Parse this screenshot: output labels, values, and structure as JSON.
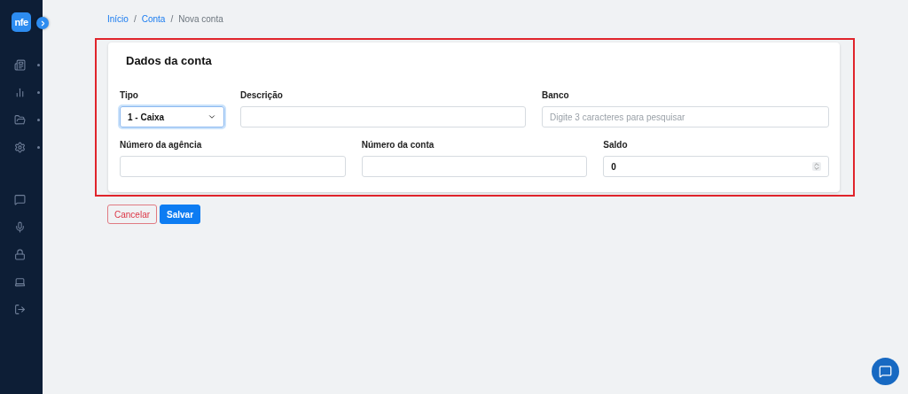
{
  "sidebar": {
    "logo": "nfe",
    "collapsed": true,
    "items": [
      {
        "has_submenu": true
      },
      {
        "has_submenu": true
      },
      {
        "has_submenu": true
      },
      {
        "has_submenu": true
      }
    ],
    "bottom_items": [
      {
        "has_submenu": false
      },
      {
        "has_submenu": false
      },
      {
        "has_submenu": false
      },
      {
        "has_submenu": false
      },
      {
        "has_submenu": false
      }
    ]
  },
  "breadcrumb": [
    {
      "label": "Início",
      "link": true
    },
    {
      "separator": "/"
    },
    {
      "label": "Conta",
      "link": true
    },
    {
      "separator": "/"
    },
    {
      "label": "Nova conta",
      "link": false
    }
  ],
  "card": {
    "title": "Dados da conta",
    "highlighted": true,
    "rows": [
      [
        {
          "kind": "select",
          "label": "Tipo",
          "value": "1 - Caixa",
          "focused": true
        },
        {
          "kind": "text",
          "label": "Descrição",
          "focused": false
        },
        {
          "kind": "text",
          "label": "Banco",
          "placeholder": "Digite 3 caracteres para pesquisar",
          "focused": false
        }
      ],
      [
        {
          "kind": "text",
          "label": "Número da agência",
          "focused": false
        },
        {
          "kind": "text",
          "label": "Número da conta",
          "focused": false
        },
        {
          "kind": "number",
          "label": "Saldo",
          "value": "0",
          "focused": false
        }
      ]
    ]
  },
  "buttons": [
    {
      "label": "Cancelar",
      "kind": "outline-danger"
    },
    {
      "label": "Salvar",
      "kind": "primary"
    }
  ]
}
